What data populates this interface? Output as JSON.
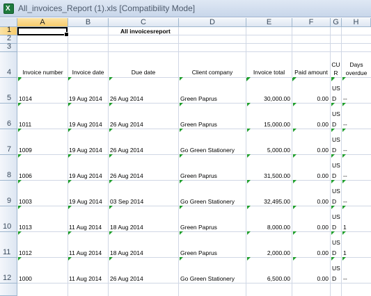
{
  "window": {
    "title": "All_invoices_Report (1).xls  [Compatibility Mode]",
    "app_icon_glyph": "X"
  },
  "columns": [
    "A",
    "B",
    "C",
    "D",
    "E",
    "F",
    "G",
    "H"
  ],
  "row_numbers": [
    "1",
    "2",
    "3",
    "4",
    "5",
    "6",
    "7",
    "8",
    "9",
    "10",
    "11",
    "12"
  ],
  "sheet_title": "All invoicesreport",
  "headers": {
    "invoice_number": "Invoice number",
    "invoice_date": "Invoice date",
    "due_date": "Due date",
    "client_company": "Client company",
    "invoice_total": "Invoice total",
    "paid_amount": "Paid amount",
    "currency": "CU R",
    "days_overdue": "Days overdue"
  },
  "rows": [
    {
      "row": "5",
      "invoice": "1014",
      "invoice_date": "19 Aug 2014",
      "due_date": "26 Aug 2014",
      "client": "Green Paprus",
      "total": "30,000.00",
      "paid": "0.00",
      "cur_1": "US",
      "cur_2": "D",
      "overdue": "--"
    },
    {
      "row": "6",
      "invoice": "1011",
      "invoice_date": "19 Aug 2014",
      "due_date": "26 Aug 2014",
      "client": "Green Paprus",
      "total": "15,000.00",
      "paid": "0.00",
      "cur_1": "US",
      "cur_2": "D",
      "overdue": "--"
    },
    {
      "row": "7",
      "invoice": "1009",
      "invoice_date": "19 Aug 2014",
      "due_date": "26 Aug 2014",
      "client": "Go Green Stationery",
      "total": "5,000.00",
      "paid": "0.00",
      "cur_1": "US",
      "cur_2": "D",
      "overdue": "--"
    },
    {
      "row": "8",
      "invoice": "1006",
      "invoice_date": "19 Aug 2014",
      "due_date": "26 Aug 2014",
      "client": "Green Paprus",
      "total": "31,500.00",
      "paid": "0.00",
      "cur_1": "US",
      "cur_2": "D",
      "overdue": "--"
    },
    {
      "row": "9",
      "invoice": "1003",
      "invoice_date": "19 Aug 2014",
      "due_date": "03 Sep 2014",
      "client": "Go Green Stationery",
      "total": "32,495.00",
      "paid": "0.00",
      "cur_1": "US",
      "cur_2": "D",
      "overdue": "--"
    },
    {
      "row": "10",
      "invoice": "1013",
      "invoice_date": "11 Aug 2014",
      "due_date": "18 Aug 2014",
      "client": "Green Paprus",
      "total": "8,000.00",
      "paid": "0.00",
      "cur_1": "US",
      "cur_2": "D",
      "overdue": "1"
    },
    {
      "row": "11",
      "invoice": "1012",
      "invoice_date": "11 Aug 2014",
      "due_date": "18 Aug 2014",
      "client": "Green Paprus",
      "total": "2,000.00",
      "paid": "0.00",
      "cur_1": "US",
      "cur_2": "D",
      "overdue": "1"
    },
    {
      "row": "12",
      "invoice": "1000",
      "invoice_date": "11 Aug 2014",
      "due_date": "26 Aug 2014",
      "client": "Go Green Stationery",
      "total": "6,500.00",
      "paid": "0.00",
      "cur_1": "US",
      "cur_2": "D",
      "overdue": "--"
    }
  ],
  "colors": {
    "grid_line": "#d0d7e5",
    "header_bg": "#dde6f2",
    "selected_header": "#f8cc6c",
    "error_triangle": "#1f9e2c"
  }
}
